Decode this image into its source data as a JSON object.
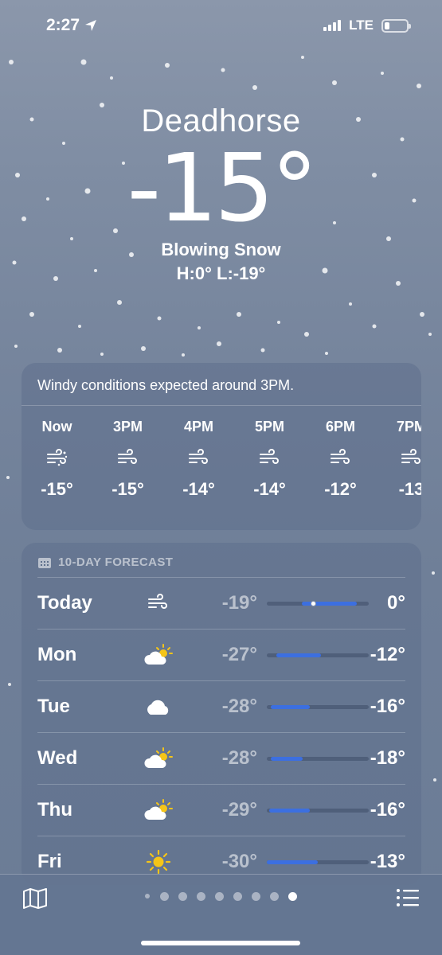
{
  "status_bar": {
    "time": "2:27",
    "network": "LTE"
  },
  "hero": {
    "city": "Deadhorse",
    "temperature": "-15°",
    "condition": "Blowing Snow",
    "hilo": "H:0°  L:-19°"
  },
  "hourly": {
    "note": "Windy conditions expected around 3PM.",
    "items": [
      {
        "label": "Now",
        "icon": "wind-snow-icon",
        "temp": "-15°"
      },
      {
        "label": "3PM",
        "icon": "wind-icon",
        "temp": "-15°"
      },
      {
        "label": "4PM",
        "icon": "wind-icon",
        "temp": "-14°"
      },
      {
        "label": "5PM",
        "icon": "wind-icon",
        "temp": "-14°"
      },
      {
        "label": "6PM",
        "icon": "wind-icon",
        "temp": "-12°"
      },
      {
        "label": "7PM",
        "icon": "wind-icon",
        "temp": "-13"
      }
    ]
  },
  "forecast": {
    "header": "10-DAY FORECAST",
    "days": [
      {
        "day": "Today",
        "icon": "wind-icon",
        "low": "-19°",
        "high": "0°",
        "range_start": 0.34,
        "range_end": 0.88,
        "current": 0.45
      },
      {
        "day": "Mon",
        "icon": "partly-sunny-icon",
        "low": "-27°",
        "high": "-12°",
        "range_start": 0.09,
        "range_end": 0.53
      },
      {
        "day": "Tue",
        "icon": "cloud-icon",
        "low": "-28°",
        "high": "-16°",
        "range_start": 0.04,
        "range_end": 0.42
      },
      {
        "day": "Wed",
        "icon": "partly-sunny-icon",
        "low": "-28°",
        "high": "-18°",
        "range_start": 0.04,
        "range_end": 0.35
      },
      {
        "day": "Thu",
        "icon": "partly-sunny-icon",
        "low": "-29°",
        "high": "-16°",
        "range_start": 0.02,
        "range_end": 0.42
      },
      {
        "day": "Fri",
        "icon": "sun-icon",
        "low": "-30°",
        "high": "-13°",
        "range_start": 0.0,
        "range_end": 0.5
      }
    ]
  },
  "pager": {
    "count": 9,
    "active_index": 8
  },
  "colors": {
    "range_bar": "#3c6fe0",
    "sun": "#f5c518"
  }
}
